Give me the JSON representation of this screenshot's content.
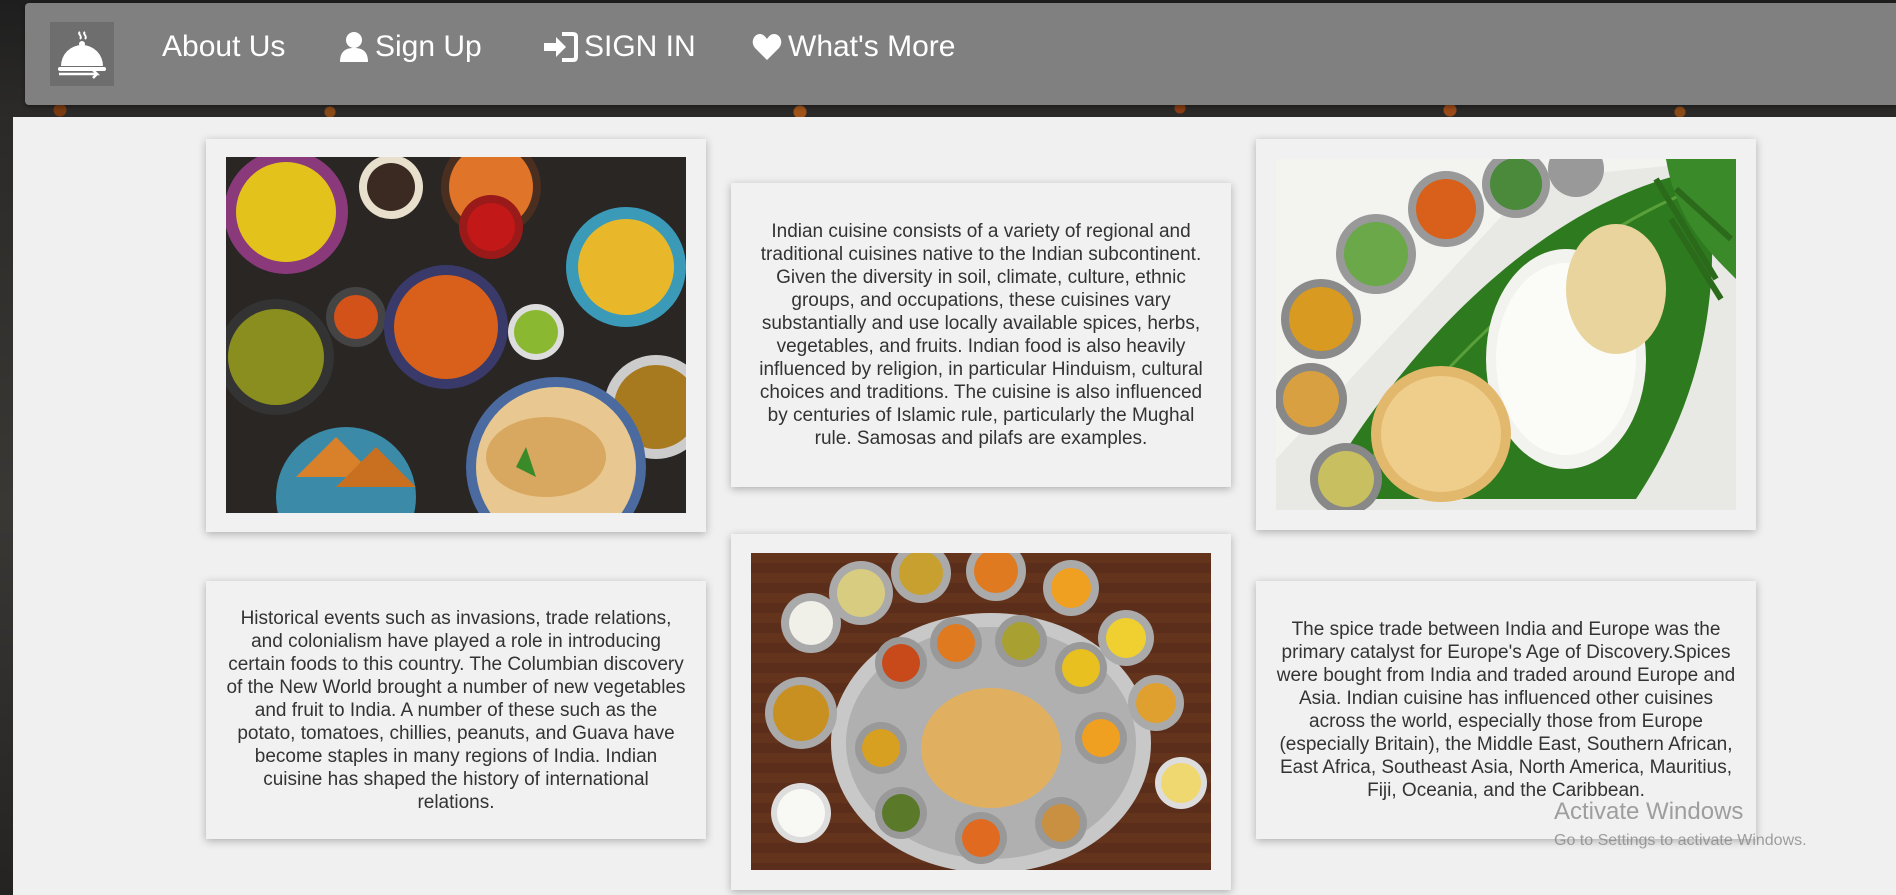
{
  "nav": {
    "logo_icon": "serving-cloche-icon",
    "links": [
      {
        "label": "About Us",
        "icon": ""
      },
      {
        "label": "Sign Up",
        "icon": "user-icon"
      },
      {
        "label": "SIGN IN",
        "icon": "sign-in-icon"
      },
      {
        "label": "What's More",
        "icon": "heart-icon"
      }
    ]
  },
  "cards": {
    "intro_text": "Indian cuisine consists of a variety of regional and traditional cuisines native to the Indian subcontinent. Given the diversity in soil, climate, culture, ethnic groups, and occupations, these cuisines vary substantially and use locally available spices, herbs, vegetables, and fruits. Indian food is also heavily influenced by religion, in particular Hinduism, cultural choices and traditions. The cuisine is also influenced by centuries of Islamic rule, particularly the Mughal rule. Samosas and pilafs are examples.",
    "history_text": "Historical events such as invasions, trade relations, and colonialism have played a role in introducing certain foods to this country. The Columbian discovery of the New World brought a number of new vegetables and fruit to India. A number of these such as the potato, tomatoes, chillies, peanuts, and Guava have become staples in many regions of India. Indian cuisine has shaped the history of international relations.",
    "spice_text": "The spice trade between India and Europe was the primary catalyst for Europe's Age of Discovery.Spices were bought from India and traded around Europe and Asia. Indian cuisine has influenced other cuisines across the world, especially those from Europe (especially Britain), the Middle East, Southern African, East Africa, Southeast Asia, North America, Mauritius, Fiji, Oceania, and the Caribbean."
  },
  "watermark": {
    "line1": "Activate Windows",
    "line2": "Go to Settings to activate Windows."
  }
}
